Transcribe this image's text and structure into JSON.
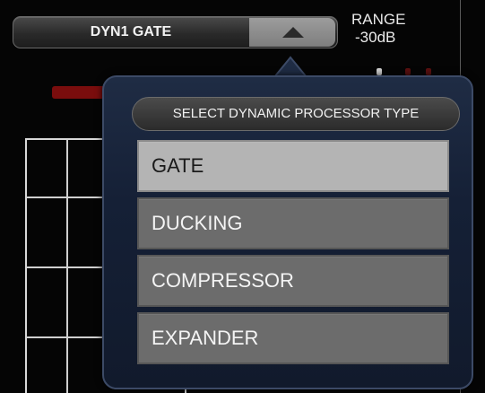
{
  "header": {
    "selector_label": "DYN1 GATE",
    "arrow_icon": "triangle-up-icon",
    "range_label": "RANGE",
    "range_value": "-30dB"
  },
  "popup": {
    "title": "SELECT DYNAMIC PROCESSOR TYPE",
    "options": [
      {
        "label": "GATE",
        "selected": true
      },
      {
        "label": "DUCKING",
        "selected": false
      },
      {
        "label": "COMPRESSOR",
        "selected": false
      },
      {
        "label": "EXPANDER",
        "selected": false
      }
    ]
  },
  "colors": {
    "popup_background": "#152036",
    "option_normal": "#6c6c6c",
    "option_selected": "#b4b4b4",
    "meter_red": "#7a0d0d"
  }
}
